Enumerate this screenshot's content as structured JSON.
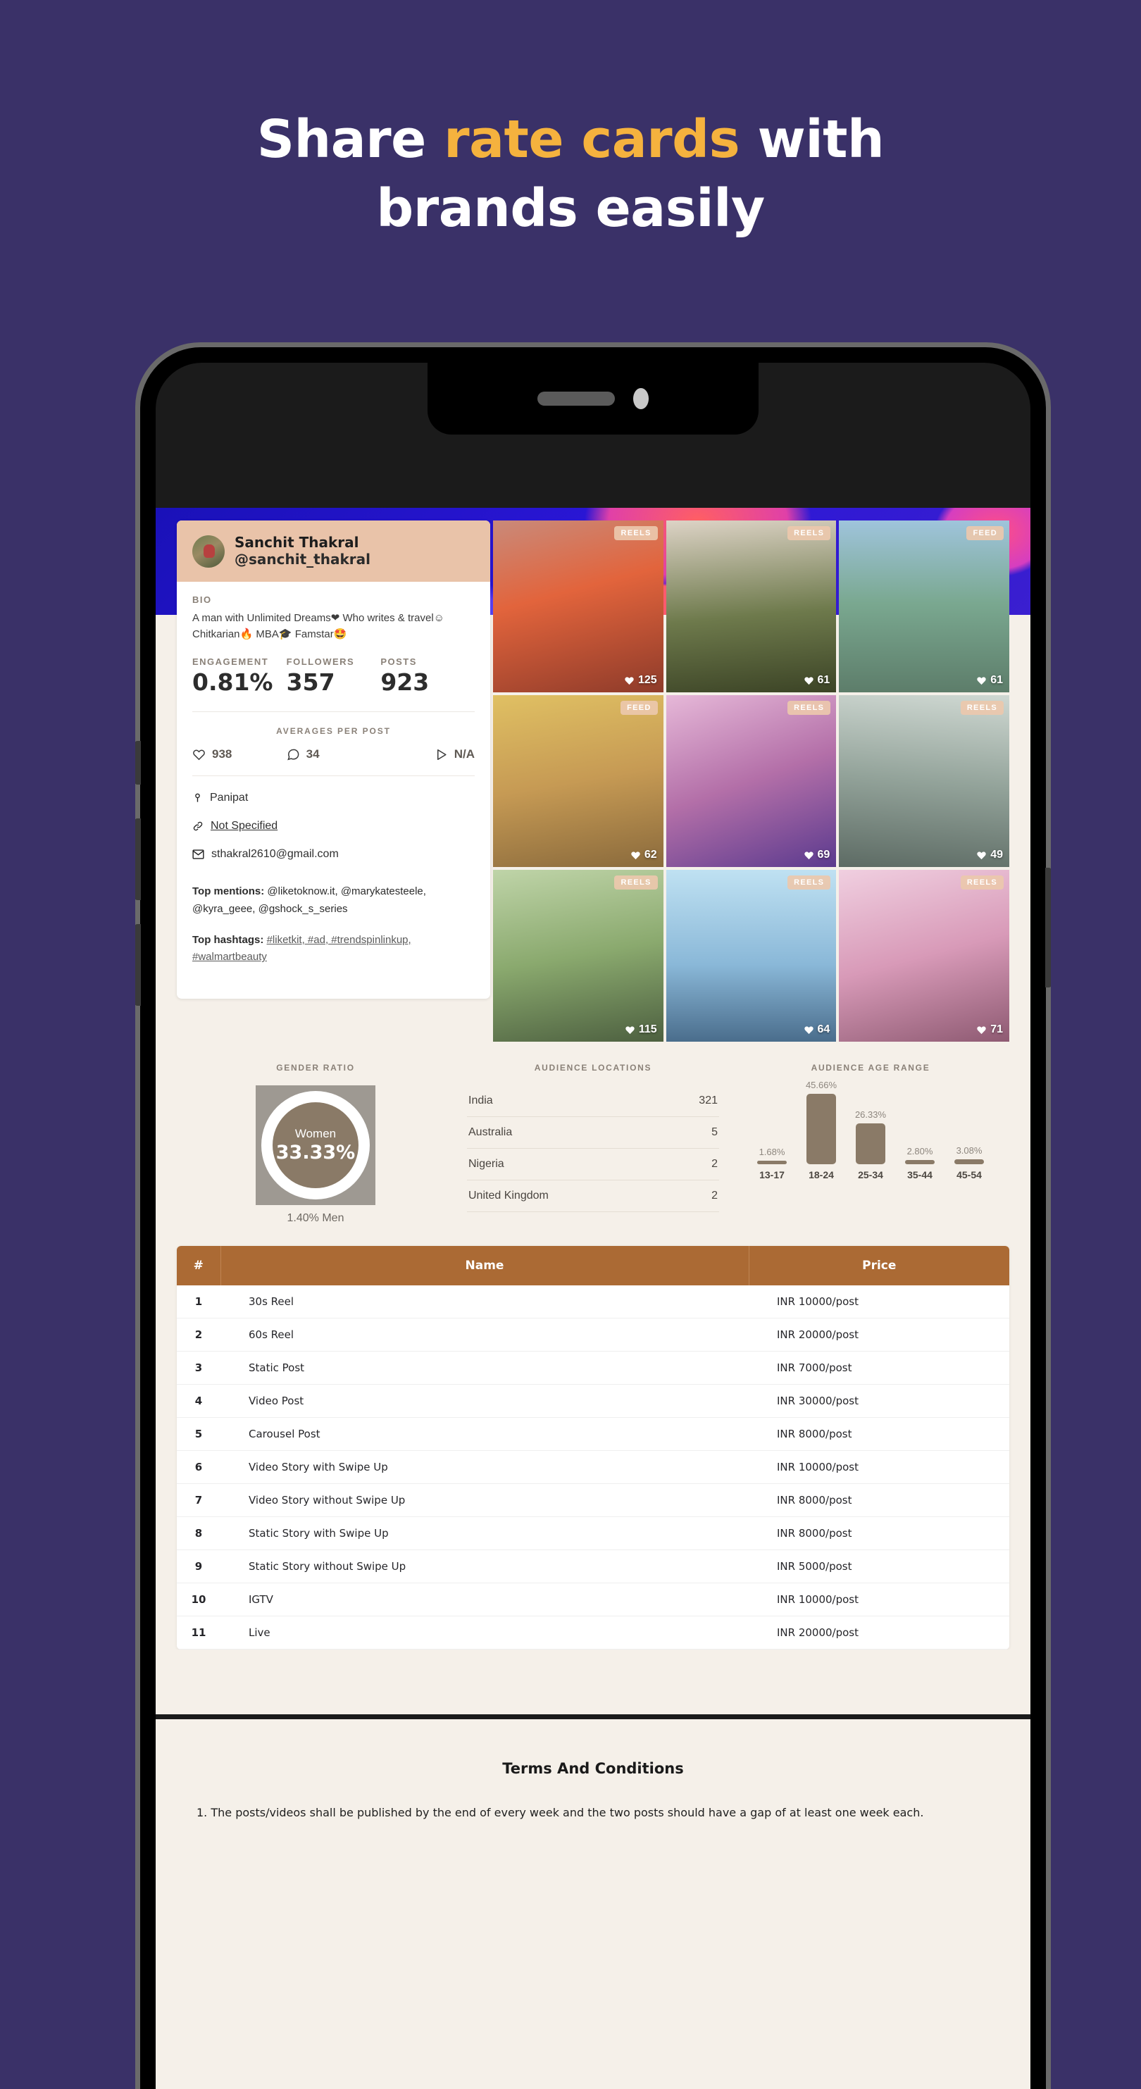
{
  "headline": {
    "line1_a": "Share ",
    "line1_accent": "rate cards",
    "line1_b": " with",
    "line2": "brands easily",
    "accent_color": "#f5b23e"
  },
  "profile": {
    "name": "Sanchit Thakral",
    "handle": "@sanchit_thakral",
    "bio_label": "BIO",
    "bio": "A man with Unlimited Dreams❤ Who writes & travel☺ Chitkarian🔥 MBA🎓 Famstar🤩",
    "stats": [
      {
        "label": "ENGAGEMENT",
        "value": "0.81%"
      },
      {
        "label": "FOLLOWERS",
        "value": "357"
      },
      {
        "label": "POSTS",
        "value": "923"
      }
    ],
    "averages_title": "AVERAGES PER POST",
    "averages": [
      {
        "icon": "heart-icon",
        "value": "938"
      },
      {
        "icon": "comment-icon",
        "value": "34"
      },
      {
        "icon": "play-icon",
        "value": "N/A"
      }
    ],
    "contact": {
      "location": "Panipat",
      "website": "Not Specified",
      "email": "sthakral2610@gmail.com"
    },
    "top_mentions_label": "Top mentions:",
    "top_mentions": "@liketoknow.it, @marykatesteele, @kyra_geee, @gshock_s_series",
    "top_hashtags_label": "Top hashtags:",
    "top_hashtags": "#liketkit, #ad, #trendspinlinkup, #walmartbeauty"
  },
  "posts": [
    {
      "badge": "REELS",
      "likes": "125"
    },
    {
      "badge": "REELS",
      "likes": "61"
    },
    {
      "badge": "FEED",
      "likes": "61"
    },
    {
      "badge": "FEED",
      "likes": "62"
    },
    {
      "badge": "REELS",
      "likes": "69"
    },
    {
      "badge": "REELS",
      "likes": "49"
    },
    {
      "badge": "REELS",
      "likes": "115"
    },
    {
      "badge": "REELS",
      "likes": "64"
    },
    {
      "badge": "REELS",
      "likes": "71"
    }
  ],
  "analytics": {
    "gender": {
      "title": "GENDER RATIO",
      "primary_label": "Women",
      "primary_value": "33.33%",
      "secondary": "1.40% Men"
    },
    "locations": {
      "title": "AUDIENCE LOCATIONS",
      "rows": [
        {
          "name": "India",
          "value": "321"
        },
        {
          "name": "Australia",
          "value": "5"
        },
        {
          "name": "Nigeria",
          "value": "2"
        },
        {
          "name": "United Kingdom",
          "value": "2"
        }
      ]
    }
  },
  "chart_data": {
    "type": "bar",
    "title": "AUDIENCE AGE RANGE",
    "categories": [
      "13-17",
      "18-24",
      "25-34",
      "35-44",
      "45-54"
    ],
    "values": [
      1.68,
      45.66,
      26.33,
      2.8,
      3.08
    ],
    "labels": [
      "1.68%",
      "45.66%",
      "26.33%",
      "2.80%",
      "3.08%"
    ],
    "xlabel": "",
    "ylabel": "",
    "ylim": [
      0,
      50
    ],
    "grid": false,
    "legend": null,
    "bar_color": "#8a7a67"
  },
  "price_table": {
    "columns": [
      "#",
      "Name",
      "Price"
    ],
    "rows": [
      {
        "num": "1",
        "name": "30s Reel",
        "price": "INR 10000/post"
      },
      {
        "num": "2",
        "name": "60s Reel",
        "price": "INR 20000/post"
      },
      {
        "num": "3",
        "name": "Static Post",
        "price": "INR 7000/post"
      },
      {
        "num": "4",
        "name": "Video Post",
        "price": "INR 30000/post"
      },
      {
        "num": "5",
        "name": "Carousel Post",
        "price": "INR 8000/post"
      },
      {
        "num": "6",
        "name": "Video Story with Swipe Up",
        "price": "INR 10000/post"
      },
      {
        "num": "7",
        "name": "Video Story without Swipe Up",
        "price": "INR 8000/post"
      },
      {
        "num": "8",
        "name": "Static Story with Swipe Up",
        "price": "INR 8000/post"
      },
      {
        "num": "9",
        "name": "Static Story without Swipe Up",
        "price": "INR 5000/post"
      },
      {
        "num": "10",
        "name": "IGTV",
        "price": "INR 10000/post"
      },
      {
        "num": "11",
        "name": "Live",
        "price": "INR 20000/post"
      }
    ],
    "header_color": "#ab6a34"
  },
  "terms": {
    "title": "Terms And Conditions",
    "item1": "1. The posts/videos shall be published by the end of every week and the two posts should have a gap of at least one week each."
  }
}
